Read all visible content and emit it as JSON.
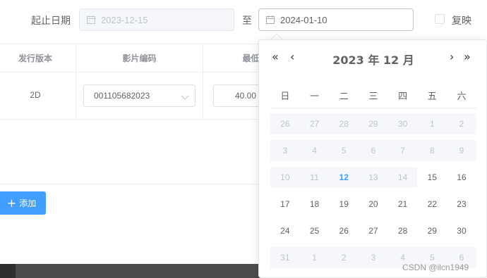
{
  "filter": {
    "date_label": "起止日期",
    "start_date": "2023-12-15",
    "to_label": "至",
    "end_date": "2024-01-10",
    "rerun_label": "复映"
  },
  "table": {
    "headers": [
      "发行版本",
      "影片编码",
      "最低"
    ],
    "row": {
      "version": "2D",
      "film_code": "001105682023",
      "min_price": "40.00"
    }
  },
  "add_button": {
    "label": "添加"
  },
  "calendar": {
    "title": "2023 年  12 月",
    "nav": {
      "prev_year": "«",
      "prev_month": "‹",
      "next_month": "›",
      "next_year": "»"
    },
    "weekdays": [
      "日",
      "一",
      "二",
      "三",
      "四",
      "五",
      "六"
    ],
    "weeks": [
      [
        {
          "d": "26",
          "s": "disabled"
        },
        {
          "d": "27",
          "s": "disabled"
        },
        {
          "d": "28",
          "s": "disabled"
        },
        {
          "d": "29",
          "s": "disabled"
        },
        {
          "d": "30",
          "s": "disabled"
        },
        {
          "d": "1",
          "s": "disabled"
        },
        {
          "d": "2",
          "s": "disabled"
        }
      ],
      [
        {
          "d": "3",
          "s": "disabled"
        },
        {
          "d": "4",
          "s": "disabled"
        },
        {
          "d": "5",
          "s": "disabled"
        },
        {
          "d": "6",
          "s": "disabled"
        },
        {
          "d": "7",
          "s": "disabled"
        },
        {
          "d": "8",
          "s": "disabled"
        },
        {
          "d": "9",
          "s": "disabled"
        }
      ],
      [
        {
          "d": "10",
          "s": "disabled"
        },
        {
          "d": "11",
          "s": "disabled"
        },
        {
          "d": "12",
          "s": "today"
        },
        {
          "d": "13",
          "s": "disabled"
        },
        {
          "d": "14",
          "s": "disabled"
        },
        {
          "d": "15",
          "s": "normal"
        },
        {
          "d": "16",
          "s": "normal"
        }
      ],
      [
        {
          "d": "17",
          "s": "normal"
        },
        {
          "d": "18",
          "s": "normal"
        },
        {
          "d": "19",
          "s": "normal"
        },
        {
          "d": "20",
          "s": "normal"
        },
        {
          "d": "21",
          "s": "normal"
        },
        {
          "d": "22",
          "s": "normal"
        },
        {
          "d": "23",
          "s": "normal"
        }
      ],
      [
        {
          "d": "24",
          "s": "normal"
        },
        {
          "d": "25",
          "s": "normal"
        },
        {
          "d": "26",
          "s": "normal"
        },
        {
          "d": "27",
          "s": "normal"
        },
        {
          "d": "28",
          "s": "normal"
        },
        {
          "d": "29",
          "s": "normal"
        },
        {
          "d": "30",
          "s": "normal"
        }
      ],
      [
        {
          "d": "31",
          "s": "disabled"
        },
        {
          "d": "1",
          "s": "disabled"
        },
        {
          "d": "2",
          "s": "disabled"
        },
        {
          "d": "3",
          "s": "disabled"
        },
        {
          "d": "4",
          "s": "disabled"
        },
        {
          "d": "5",
          "s": "disabled"
        },
        {
          "d": "6",
          "s": "disabled"
        }
      ]
    ]
  },
  "watermark": "CSDN @ilcn1949",
  "colors": {
    "accent": "#409eff",
    "disabled_bg": "#f5f7fa",
    "disabled_text": "#c0c4cc"
  }
}
